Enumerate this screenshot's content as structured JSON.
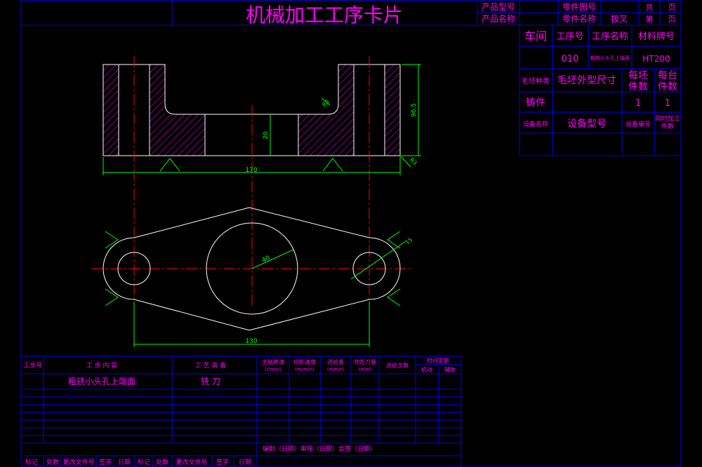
{
  "header": {
    "title": "机械加工工序卡片",
    "product_model_label": "产品型号",
    "product_name_label": "产品名称",
    "part_drawing_no_label": "零件图号",
    "part_name_label": "零件名称",
    "part_name_value": "拨叉",
    "total_label": "共",
    "page_unit_1": "页",
    "sheet_label": "第",
    "page_unit_2": "页"
  },
  "info": {
    "workshop_label": "车间",
    "op_no_label": "工序号",
    "op_name_label": "工序名称",
    "material_label": "材料牌号",
    "op_no_value": "010",
    "op_name_value": "粗铣小头孔上端面",
    "material_value": "HT200",
    "blank_type_label": "毛坯种类",
    "blank_size_label": "毛坯外型尺寸",
    "per_blank_label_1": "每坯",
    "per_blank_label_2": "件数",
    "per_machine_label_1": "每台",
    "per_machine_label_2": "件数",
    "blank_type_value": "铸件",
    "per_blank_value": "1",
    "per_machine_value": "1",
    "equip_name_label": "设备名称",
    "equip_model_label": "设备型号",
    "equip_no_label": "设备编号",
    "concurrent_label_1": "同时加工",
    "concurrent_label_2": "件数"
  },
  "drawing": {
    "dim_width_top": "170",
    "dim_height_right": "96.5",
    "dim_slot": "20",
    "roughness_a": "R3",
    "roughness_b": "R3",
    "dim_width_bottom": "130",
    "dim_diameter_center": "40",
    "dim_small_radius": "15"
  },
  "steps_table": {
    "step_no_label": "工步号",
    "step_content_label": "工 步 内 容",
    "equipment_label": "工 艺 装 备",
    "spindle_speed_label_1": "主轴转速",
    "spindle_speed_label_2": "(r/min)",
    "cutting_speed_label_1": "切削速度",
    "cutting_speed_label_2": "(m/min)",
    "feed_label_1": "进给量",
    "feed_label_2": "(mm/r)",
    "depth_label_1": "背吃刀量",
    "depth_label_2": "(mm)",
    "passes_label": "进给次数",
    "time_label": "时间定额",
    "machine_time_label": "机动",
    "aux_time_label": "辅助",
    "rows": [
      {
        "content": "粗铣小头孔上端面",
        "equipment": "铣 刀"
      }
    ]
  },
  "signoff": {
    "summary": "编制（日期）审核（日期）会签（日期）",
    "footer_labels": [
      "标记",
      "处数",
      "更改文件号",
      "签字",
      "日期",
      "标记",
      "处数",
      "更改文件号",
      "签字",
      "日期"
    ]
  }
}
